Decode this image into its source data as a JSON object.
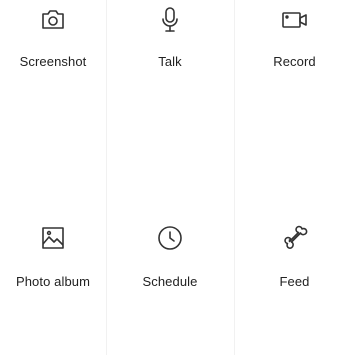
{
  "colors": {
    "icon": "#333333",
    "label": "#222222",
    "background": "#ffffff",
    "divider": "#f1f1f1"
  },
  "tiles": [
    {
      "label": "Screenshot",
      "icon": "camera-icon"
    },
    {
      "label": "Talk",
      "icon": "microphone-icon"
    },
    {
      "label": "Record",
      "icon": "video-camera-icon"
    },
    {
      "label": "Photo album",
      "icon": "image-icon"
    },
    {
      "label": "Schedule",
      "icon": "clock-icon"
    },
    {
      "label": "Feed",
      "icon": "bone-icon"
    }
  ]
}
